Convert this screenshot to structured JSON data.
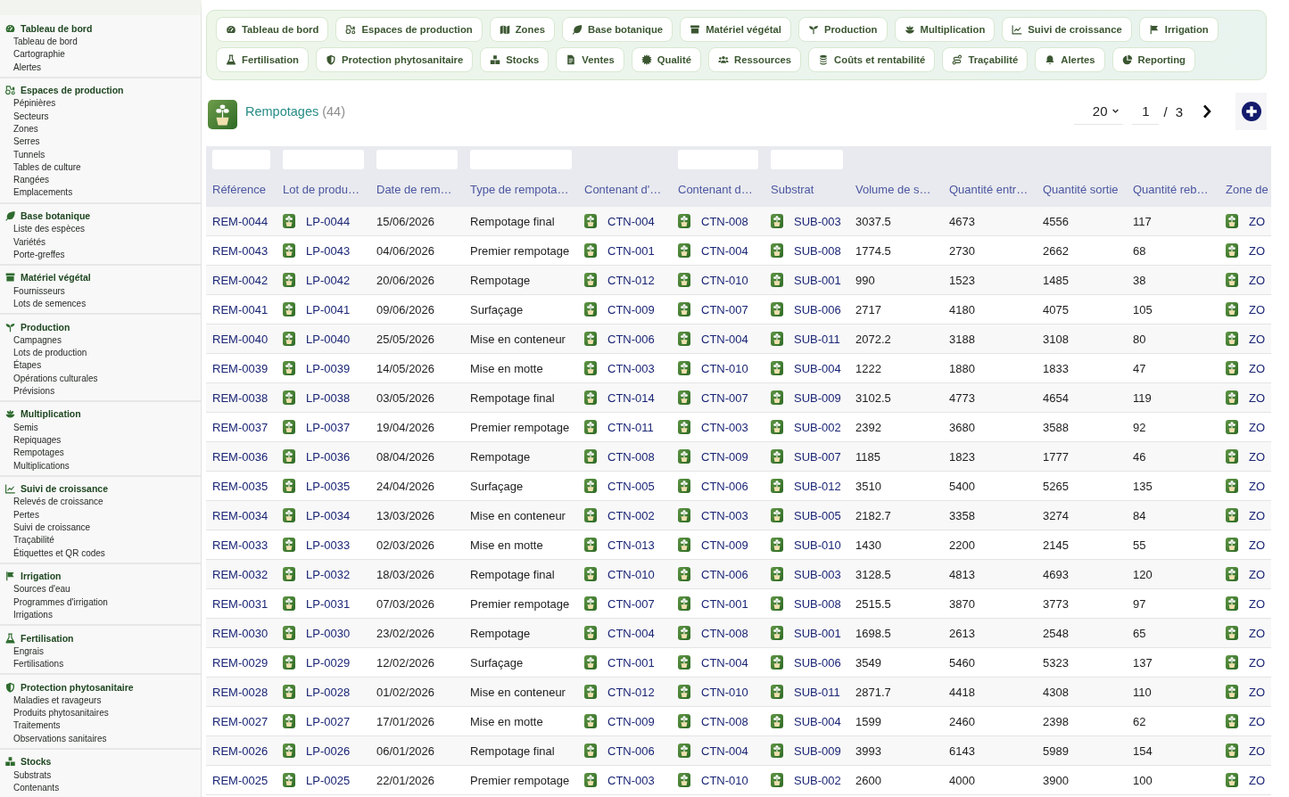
{
  "sidebar": {
    "groups": [
      {
        "title": "Tableau de bord",
        "items": [
          "Tableau de bord",
          "Cartographie",
          "Alertes"
        ]
      },
      {
        "title": "Espaces de production",
        "items": [
          "Pépinières",
          "Secteurs",
          "Zones",
          "Serres",
          "Tunnels",
          "Tables de culture",
          "Rangées",
          "Emplacements"
        ]
      },
      {
        "title": "Base botanique",
        "items": [
          "Liste des espèces",
          "Variétés",
          "Porte-greffes"
        ]
      },
      {
        "title": "Matériel végétal",
        "items": [
          "Fournisseurs",
          "Lots de semences"
        ]
      },
      {
        "title": "Production",
        "items": [
          "Campagnes",
          "Lots de production",
          "Étapes",
          "Opérations culturales",
          "Prévisions"
        ]
      },
      {
        "title": "Multiplication",
        "items": [
          "Semis",
          "Repiquages",
          "Rempotages",
          "Multiplications"
        ]
      },
      {
        "title": "Suivi de croissance",
        "items": [
          "Relevés de croissance",
          "Pertes",
          "Suivi de croissance",
          "Traçabilité",
          "Étiquettes et QR codes"
        ]
      },
      {
        "title": "Irrigation",
        "items": [
          "Sources d'eau",
          "Programmes d'irrigation",
          "Irrigations"
        ]
      },
      {
        "title": "Fertilisation",
        "items": [
          "Engrais",
          "Fertilisations"
        ]
      },
      {
        "title": "Protection phytosanitaire",
        "items": [
          "Maladies et ravageurs",
          "Produits phytosanitaires",
          "Traitements",
          "Observations sanitaires"
        ]
      },
      {
        "title": "Stocks",
        "items": [
          "Substrats",
          "Contenants"
        ]
      }
    ]
  },
  "nav_tabs": [
    "Tableau de bord",
    "Espaces de production",
    "Zones",
    "Base botanique",
    "Matériel végétal",
    "Production",
    "Multiplication",
    "Suivi de croissance",
    "Irrigation",
    "Fertilisation",
    "Protection phytosanitaire",
    "Stocks",
    "Ventes",
    "Qualité",
    "Ressources",
    "Coûts et rentabilité",
    "Traçabilité",
    "Alertes",
    "Reporting"
  ],
  "header": {
    "title": "Rempotages",
    "count": "(44)",
    "page_size": "20",
    "page": "1",
    "page_separator": "/",
    "total_pages": "3"
  },
  "table": {
    "columns": [
      {
        "label": "Référence",
        "kind": "ref",
        "filter": true
      },
      {
        "label": "Lot de produ…",
        "kind": "link",
        "filter": true
      },
      {
        "label": "Date de rem…",
        "kind": "text",
        "filter": true
      },
      {
        "label": "Type de rempota…",
        "kind": "text",
        "filter": true
      },
      {
        "label": "Contenant d'…",
        "kind": "link",
        "filter": false
      },
      {
        "label": "Contenant d…",
        "kind": "link",
        "filter": true
      },
      {
        "label": "Substrat",
        "kind": "link",
        "filter": true
      },
      {
        "label": "Volume de s…",
        "kind": "text",
        "filter": false
      },
      {
        "label": "Quantité entr…",
        "kind": "text",
        "filter": false
      },
      {
        "label": "Quantité sortie",
        "kind": "text",
        "filter": false
      },
      {
        "label": "Quantité reb…",
        "kind": "text",
        "filter": false
      },
      {
        "label": "Zone de",
        "kind": "link",
        "filter": false
      }
    ],
    "rows": [
      [
        "REM-0044",
        "LP-0044",
        "15/06/2026",
        "Rempotage final",
        "CTN-004",
        "CTN-008",
        "SUB-003",
        "3037.5",
        "4673",
        "4556",
        "117",
        "ZO"
      ],
      [
        "REM-0043",
        "LP-0043",
        "04/06/2026",
        "Premier rempotage",
        "CTN-001",
        "CTN-004",
        "SUB-008",
        "1774.5",
        "2730",
        "2662",
        "68",
        "ZO"
      ],
      [
        "REM-0042",
        "LP-0042",
        "20/06/2026",
        "Rempotage",
        "CTN-012",
        "CTN-010",
        "SUB-001",
        "990",
        "1523",
        "1485",
        "38",
        "ZO"
      ],
      [
        "REM-0041",
        "LP-0041",
        "09/06/2026",
        "Surfaçage",
        "CTN-009",
        "CTN-007",
        "SUB-006",
        "2717",
        "4180",
        "4075",
        "105",
        "ZO"
      ],
      [
        "REM-0040",
        "LP-0040",
        "25/05/2026",
        "Mise en conteneur",
        "CTN-006",
        "CTN-004",
        "SUB-011",
        "2072.2",
        "3188",
        "3108",
        "80",
        "ZO"
      ],
      [
        "REM-0039",
        "LP-0039",
        "14/05/2026",
        "Mise en motte",
        "CTN-003",
        "CTN-010",
        "SUB-004",
        "1222",
        "1880",
        "1833",
        "47",
        "ZO"
      ],
      [
        "REM-0038",
        "LP-0038",
        "03/05/2026",
        "Rempotage final",
        "CTN-014",
        "CTN-007",
        "SUB-009",
        "3102.5",
        "4773",
        "4654",
        "119",
        "ZO"
      ],
      [
        "REM-0037",
        "LP-0037",
        "19/04/2026",
        "Premier rempotage",
        "CTN-011",
        "CTN-003",
        "SUB-002",
        "2392",
        "3680",
        "3588",
        "92",
        "ZO"
      ],
      [
        "REM-0036",
        "LP-0036",
        "08/04/2026",
        "Rempotage",
        "CTN-008",
        "CTN-009",
        "SUB-007",
        "1185",
        "1823",
        "1777",
        "46",
        "ZO"
      ],
      [
        "REM-0035",
        "LP-0035",
        "24/04/2026",
        "Surfaçage",
        "CTN-005",
        "CTN-006",
        "SUB-012",
        "3510",
        "5400",
        "5265",
        "135",
        "ZO"
      ],
      [
        "REM-0034",
        "LP-0034",
        "13/03/2026",
        "Mise en conteneur",
        "CTN-002",
        "CTN-003",
        "SUB-005",
        "2182.7",
        "3358",
        "3274",
        "84",
        "ZO"
      ],
      [
        "REM-0033",
        "LP-0033",
        "02/03/2026",
        "Mise en motte",
        "CTN-013",
        "CTN-009",
        "SUB-010",
        "1430",
        "2200",
        "2145",
        "55",
        "ZO"
      ],
      [
        "REM-0032",
        "LP-0032",
        "18/03/2026",
        "Rempotage final",
        "CTN-010",
        "CTN-006",
        "SUB-003",
        "3128.5",
        "4813",
        "4693",
        "120",
        "ZO"
      ],
      [
        "REM-0031",
        "LP-0031",
        "07/03/2026",
        "Premier rempotage",
        "CTN-007",
        "CTN-001",
        "SUB-008",
        "2515.5",
        "3870",
        "3773",
        "97",
        "ZO"
      ],
      [
        "REM-0030",
        "LP-0030",
        "23/02/2026",
        "Rempotage",
        "CTN-004",
        "CTN-008",
        "SUB-001",
        "1698.5",
        "2613",
        "2548",
        "65",
        "ZO"
      ],
      [
        "REM-0029",
        "LP-0029",
        "12/02/2026",
        "Surfaçage",
        "CTN-001",
        "CTN-004",
        "SUB-006",
        "3549",
        "5460",
        "5323",
        "137",
        "ZO"
      ],
      [
        "REM-0028",
        "LP-0028",
        "01/02/2026",
        "Mise en conteneur",
        "CTN-012",
        "CTN-010",
        "SUB-011",
        "2871.7",
        "4418",
        "4308",
        "110",
        "ZO"
      ],
      [
        "REM-0027",
        "LP-0027",
        "17/01/2026",
        "Mise en motte",
        "CTN-009",
        "CTN-008",
        "SUB-004",
        "1599",
        "2460",
        "2398",
        "62",
        "ZO"
      ],
      [
        "REM-0026",
        "LP-0026",
        "06/01/2026",
        "Rempotage final",
        "CTN-006",
        "CTN-004",
        "SUB-009",
        "3993",
        "6143",
        "5989",
        "154",
        "ZO"
      ],
      [
        "REM-0025",
        "LP-0025",
        "22/01/2026",
        "Premier rempotage",
        "CTN-003",
        "CTN-010",
        "SUB-002",
        "2600",
        "4000",
        "3900",
        "100",
        "ZO"
      ]
    ]
  }
}
